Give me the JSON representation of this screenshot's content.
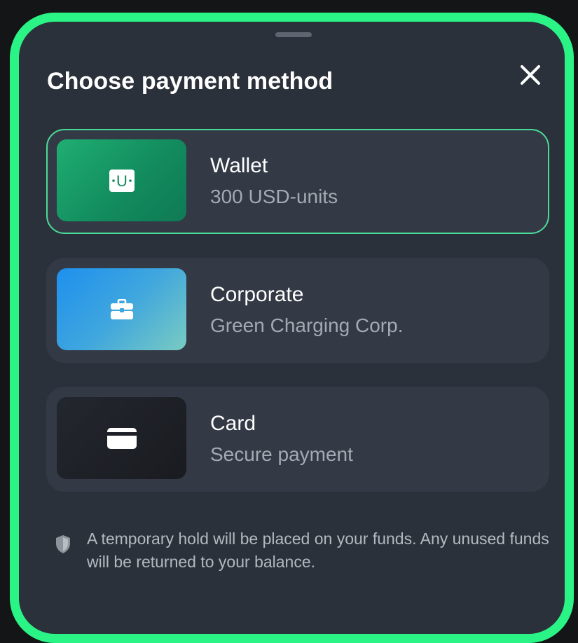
{
  "sheet": {
    "title": "Choose payment method",
    "close_icon": "close-icon"
  },
  "options": [
    {
      "id": "wallet",
      "title": "Wallet",
      "subtitle": "300 USD-units",
      "selected": true,
      "icon": "wallet-u-icon",
      "icon_text": "U"
    },
    {
      "id": "corporate",
      "title": "Corporate",
      "subtitle": "Green Charging Corp.",
      "selected": false,
      "icon": "briefcase-icon"
    },
    {
      "id": "card",
      "title": "Card",
      "subtitle": "Secure payment",
      "selected": false,
      "icon": "credit-card-icon"
    }
  ],
  "notice": {
    "icon": "shield-icon",
    "text": "A temporary hold will be placed on your funds. Any unused funds will be returned to your balance."
  },
  "colors": {
    "frame_border": "#2BF486",
    "sheet_bg": "#2B313B",
    "option_bg": "#333A45",
    "selected_border": "#4BDB99",
    "wallet_green": "#1FAE72",
    "corporate_blue": "#1E90EE",
    "card_dark": "#1D2026"
  }
}
